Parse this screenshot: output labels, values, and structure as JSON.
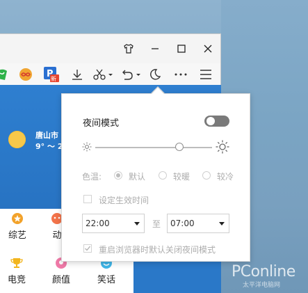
{
  "weather": {
    "city": "唐山市",
    "temperature": "9° ～ 2"
  },
  "apps": [
    {
      "label": "综艺",
      "icon": "star-icon"
    },
    {
      "label": "动",
      "icon": "animation-icon"
    },
    {
      "label": "电竞",
      "icon": "trophy-icon"
    },
    {
      "label": "颜值",
      "icon": "beauty-icon"
    },
    {
      "label": "笑话",
      "icon": "joke-icon"
    }
  ],
  "popup": {
    "title": "夜间模式",
    "toggle_on": false,
    "brightness_level": 0.72,
    "color_temp_label": "色温:",
    "color_temp_options": [
      "默认",
      "较暖",
      "较冷"
    ],
    "color_temp_selected": "默认",
    "schedule_label": "设定生效时间",
    "schedule_checked": false,
    "start_time": "22:00",
    "to_label": "至",
    "end_time": "07:00",
    "restart_label": "重启浏览器时默认关闭夜间模式",
    "restart_checked": true
  },
  "watermark": {
    "brand": "PConline",
    "sub": "太平洋电脑网"
  },
  "colors": {
    "accent_blue": "#2a78c8",
    "toggle_off": "#7a7a7a",
    "disabled_text": "#adadad"
  }
}
